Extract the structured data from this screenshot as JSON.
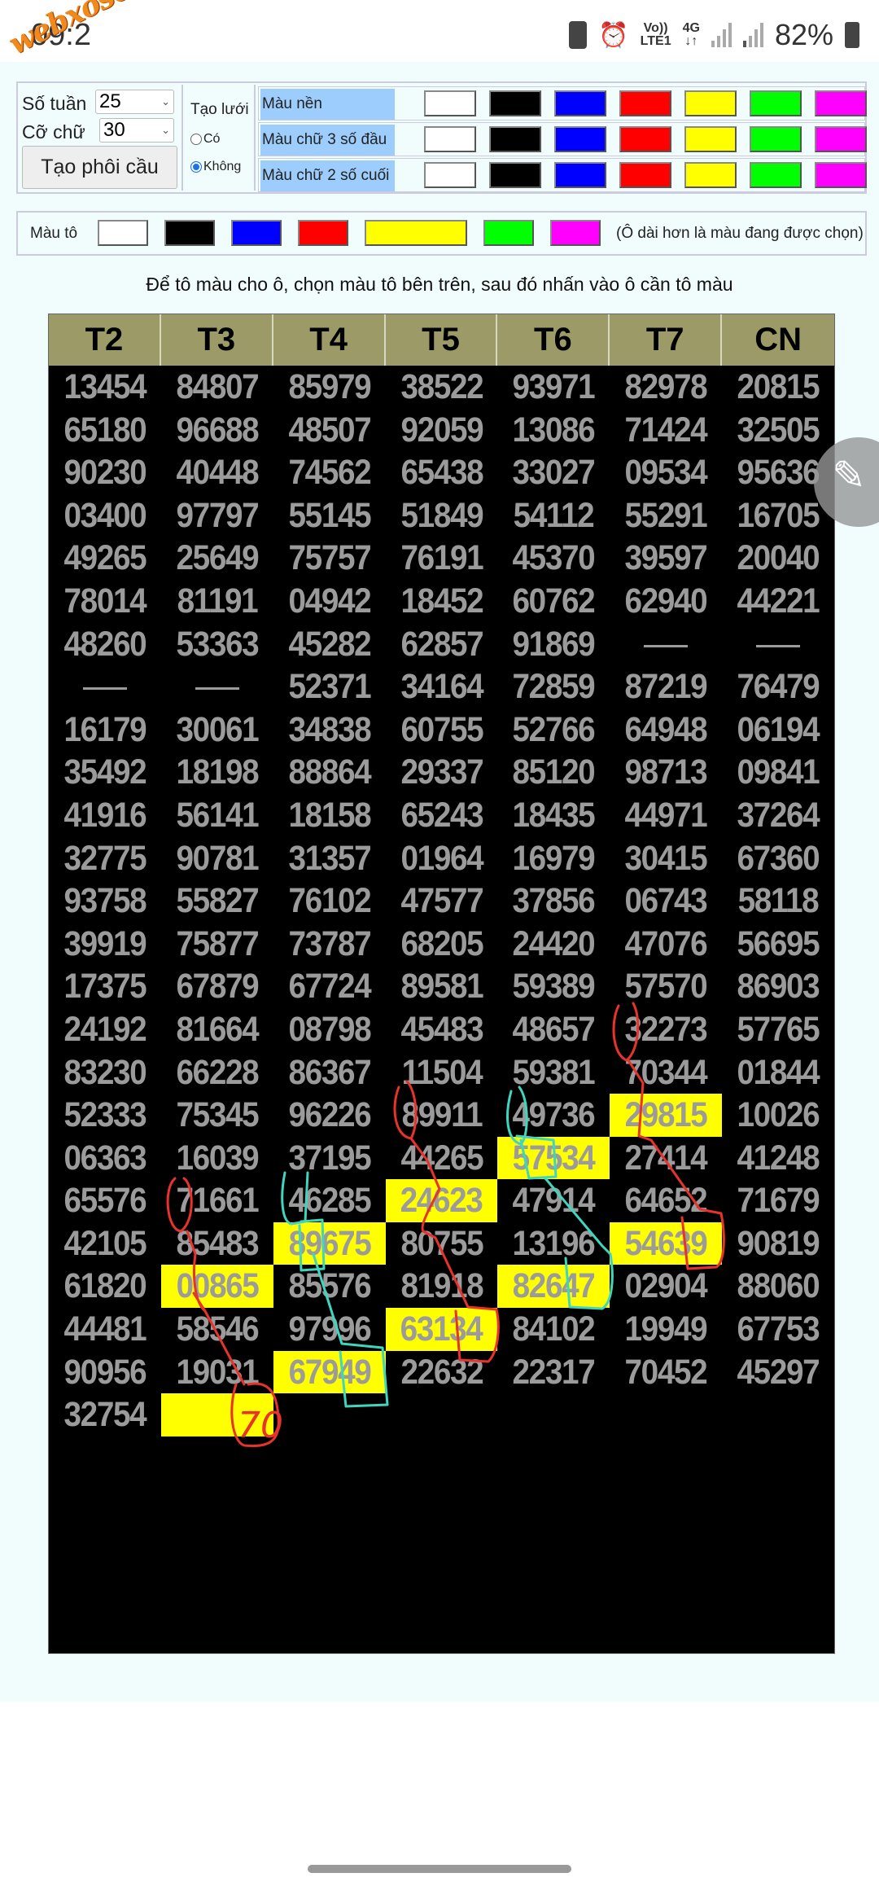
{
  "status_bar": {
    "time": "09:2",
    "network_top": "Vo))",
    "network_bottom": "LTE1",
    "net_type": "4G",
    "battery": "82%"
  },
  "watermark": "webxoso.net",
  "controls": {
    "so_tuan_label": "Số tuần",
    "so_tuan_value": "25",
    "co_chu_label": "Cỡ chữ",
    "co_chu_value": "30",
    "generate_button": "Tạo phôi cầu",
    "grid_label": "Tạo lưới",
    "grid_options": [
      {
        "label": "Có",
        "selected": false
      },
      {
        "label": "Không",
        "selected": true
      }
    ],
    "color_rows": [
      "Màu nền",
      "Màu chữ 3 số đầu",
      "Màu chữ 2 số cuối"
    ],
    "palette": [
      "#ffffff",
      "#000000",
      "#0000ff",
      "#ff0000",
      "#ffff00",
      "#00ff00",
      "#ff00ff"
    ]
  },
  "paint": {
    "label": "Màu tô",
    "selected_color": "#ffff00",
    "note": "(Ô dài hơn là màu đang được chọn)"
  },
  "instruction": "Để tô màu cho ô, chọn màu tô bên trên, sau đó nhấn vào ô cần tô màu",
  "table": {
    "headers": [
      "T2",
      "T3",
      "T4",
      "T5",
      "T6",
      "T7",
      "CN"
    ],
    "highlight_color": "#ffff00",
    "rows": [
      [
        "13454",
        "84807",
        "85979",
        "38522",
        "93971",
        "82978",
        "20815"
      ],
      [
        "65180",
        "96688",
        "48507",
        "92059",
        "13086",
        "71424",
        "32505"
      ],
      [
        "90230",
        "40448",
        "74562",
        "65438",
        "33027",
        "09534",
        "95636"
      ],
      [
        "03400",
        "97797",
        "55145",
        "51849",
        "54112",
        "55291",
        "16705"
      ],
      [
        "49265",
        "25649",
        "75757",
        "76191",
        "45370",
        "39597",
        "20040"
      ],
      [
        "78014",
        "81191",
        "04942",
        "18452",
        "60762",
        "62940",
        "44221"
      ],
      [
        "48260",
        "53363",
        "45282",
        "62857",
        "91869",
        "—",
        "—"
      ],
      [
        "—",
        "—",
        "52371",
        "34164",
        "72859",
        "87219",
        "76479"
      ],
      [
        "16179",
        "30061",
        "34838",
        "60755",
        "52766",
        "64948",
        "06194"
      ],
      [
        "35492",
        "18198",
        "88864",
        "29337",
        "85120",
        "98713",
        "09841"
      ],
      [
        "41916",
        "56141",
        "18158",
        "65243",
        "18435",
        "44971",
        "37264"
      ],
      [
        "32775",
        "90781",
        "31357",
        "01964",
        "16979",
        "30415",
        "67360"
      ],
      [
        "93758",
        "55827",
        "76102",
        "47577",
        "37856",
        "06743",
        "58118"
      ],
      [
        "39919",
        "75877",
        "73787",
        "68205",
        "24420",
        "47076",
        "56695"
      ],
      [
        "17375",
        "67879",
        "67724",
        "89581",
        "59389",
        "57570",
        "86903"
      ],
      [
        "24192",
        "81664",
        "08798",
        "45483",
        "48657",
        "32273",
        "57765"
      ],
      [
        "83230",
        "66228",
        "86367",
        "11504",
        "59381",
        "70344",
        "01844"
      ],
      [
        "52333",
        "75345",
        "96226",
        "89911",
        "49736",
        "29815",
        "10026"
      ],
      [
        "06363",
        "16039",
        "37195",
        "44265",
        "57534",
        "27414",
        "41248"
      ],
      [
        "65576",
        "71661",
        "46285",
        "24623",
        "47914",
        "64652",
        "71679"
      ],
      [
        "42105",
        "85483",
        "89675",
        "80755",
        "13196",
        "54639",
        "90819"
      ],
      [
        "61820",
        "00865",
        "85576",
        "81918",
        "82647",
        "02904",
        "88060"
      ],
      [
        "44481",
        "58546",
        "97996",
        "63134",
        "84102",
        "19949",
        "67753"
      ],
      [
        "90956",
        "19031",
        "67949",
        "22632",
        "22317",
        "70452",
        "45297"
      ],
      [
        "32754",
        "",
        "",
        "",
        "",
        "",
        ""
      ]
    ],
    "highlighted_cells": [
      [
        17,
        5
      ],
      [
        18,
        4
      ],
      [
        19,
        3
      ],
      [
        20,
        2
      ],
      [
        20,
        5
      ],
      [
        21,
        1
      ],
      [
        21,
        4
      ],
      [
        22,
        3
      ],
      [
        23,
        2
      ],
      [
        24,
        1
      ]
    ]
  },
  "annotation": {
    "handwritten": "70",
    "colors": [
      "#e8322c",
      "#3fd6c0"
    ]
  }
}
